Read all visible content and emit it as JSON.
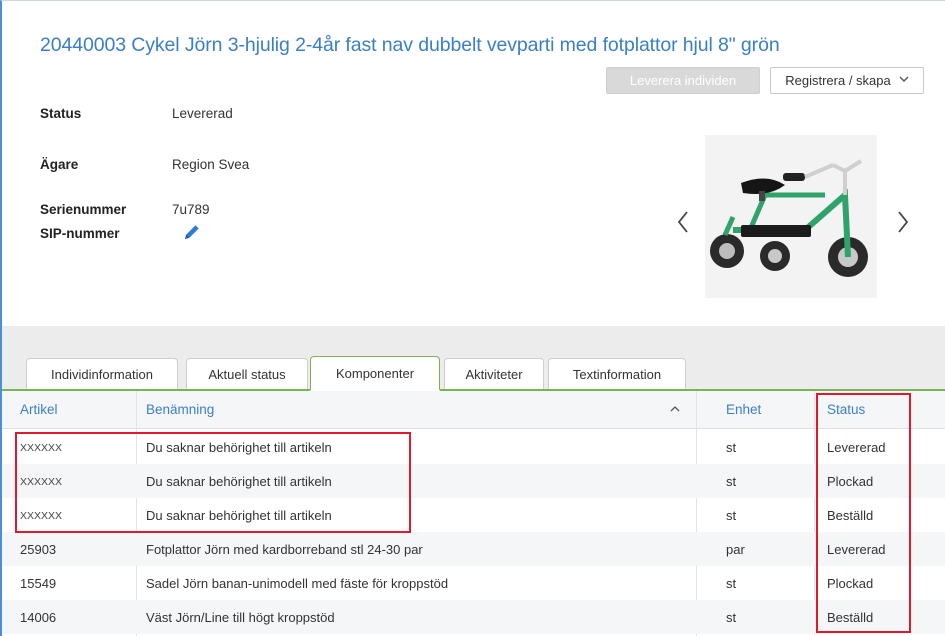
{
  "header": {
    "title": "20440003 Cykel Jörn 3-hjulig 2-4år fast nav dubbelt vevparti med fotplattor hjul 8\" grön",
    "deliver_button": "Leverera individen",
    "register_button": "Registrera / skapa"
  },
  "details": {
    "status_label": "Status",
    "status_value": "Levererad",
    "owner_label": "Ägare",
    "owner_value": "Region Svea",
    "serial_label": "Serienummer",
    "serial_value": "7u789",
    "sip_label": "SIP-nummer"
  },
  "icons": {
    "edit": "pencil-icon",
    "prev": "chevron-left-icon",
    "next": "chevron-right-icon",
    "dropdown": "chevron-down-icon",
    "sort": "caret-up-icon"
  },
  "colors": {
    "link_blue": "#3b7fc4",
    "tab_active_green": "#7ab356",
    "highlight_red": "#e0192d"
  },
  "tabs": [
    {
      "label": "Individinformation",
      "active": false
    },
    {
      "label": "Aktuell status",
      "active": false
    },
    {
      "label": "Komponenter",
      "active": true
    },
    {
      "label": "Aktiviteter",
      "active": false
    },
    {
      "label": "Textinformation",
      "active": false
    }
  ],
  "table": {
    "columns": [
      "Artikel",
      "Benämning",
      "Enhet",
      "Status"
    ],
    "rows": [
      {
        "artikel": "XXXXXX",
        "benamning": "Du saknar behörighet till artikeln",
        "enhet": "st",
        "status": "Levererad"
      },
      {
        "artikel": "XXXXXX",
        "benamning": "Du saknar behörighet till artikeln",
        "enhet": "st",
        "status": "Plockad"
      },
      {
        "artikel": "XXXXXX",
        "benamning": "Du saknar behörighet till artikeln",
        "enhet": "st",
        "status": "Beställd"
      },
      {
        "artikel": "25903",
        "benamning": "Fotplattor Jörn med kardborreband stl 24-30 par",
        "enhet": "par",
        "status": "Levererad"
      },
      {
        "artikel": "15549",
        "benamning": "Sadel Jörn banan-unimodell med fäste för kroppstöd",
        "enhet": "st",
        "status": "Plockad"
      },
      {
        "artikel": "14006",
        "benamning": "Väst Jörn/Line till högt kroppstöd",
        "enhet": "st",
        "status": "Beställd"
      }
    ]
  }
}
